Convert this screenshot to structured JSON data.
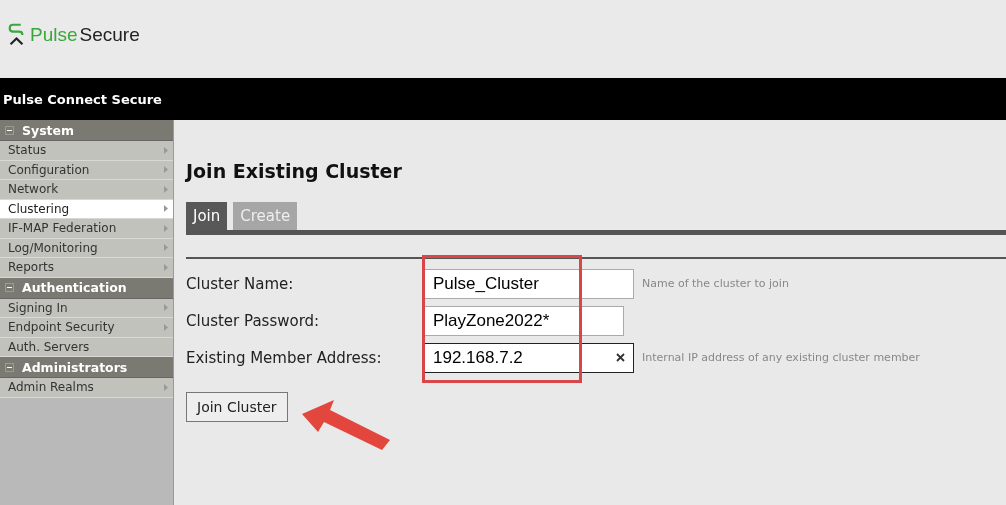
{
  "logo": {
    "part_1": "Pulse",
    "part_2": "Secure"
  },
  "product_bar": {
    "title": "Pulse Connect Secure"
  },
  "sidebar": {
    "sections": [
      {
        "title": "System",
        "expanded": true,
        "items": [
          {
            "label": "Status",
            "selected": false,
            "has_submenu": true
          },
          {
            "label": "Configuration",
            "selected": false,
            "has_submenu": true
          },
          {
            "label": "Network",
            "selected": false,
            "has_submenu": true
          },
          {
            "label": "Clustering",
            "selected": true,
            "has_submenu": true
          },
          {
            "label": "IF-MAP Federation",
            "selected": false,
            "has_submenu": true
          },
          {
            "label": "Log/Monitoring",
            "selected": false,
            "has_submenu": true
          },
          {
            "label": "Reports",
            "selected": false,
            "has_submenu": true
          }
        ]
      },
      {
        "title": "Authentication",
        "expanded": true,
        "items": [
          {
            "label": "Signing In",
            "selected": false,
            "has_submenu": true
          },
          {
            "label": "Endpoint Security",
            "selected": false,
            "has_submenu": true
          },
          {
            "label": "Auth. Servers",
            "selected": false,
            "has_submenu": false
          }
        ]
      },
      {
        "title": "Administrators",
        "expanded": true,
        "items": [
          {
            "label": "Admin Realms",
            "selected": false,
            "has_submenu": true
          }
        ]
      }
    ]
  },
  "page": {
    "title": "Join Existing Cluster",
    "tabs": [
      {
        "label": "Join",
        "selected": true
      },
      {
        "label": "Create",
        "selected": false
      }
    ],
    "fields": [
      {
        "label": "Cluster Name:",
        "value": "Pulse_Cluster",
        "hint": "Name of the cluster to join",
        "clearable": false
      },
      {
        "label": "Cluster Password:",
        "value": "PlayZone2022*",
        "clearable": false
      },
      {
        "label": "Existing Member Address:",
        "value": "192.168.7.2",
        "hint": "Internal IP address of any existing cluster member",
        "clearable": true
      }
    ],
    "fields_highlighted": true,
    "button": "Join Cluster"
  }
}
